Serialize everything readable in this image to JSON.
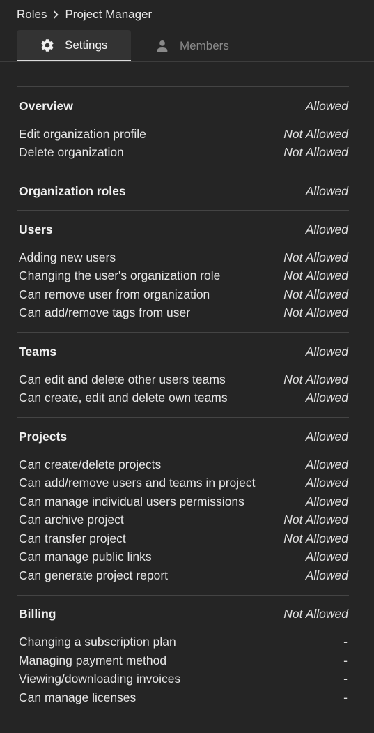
{
  "breadcrumb": {
    "root": "Roles",
    "current": "Project Manager"
  },
  "tabs": [
    {
      "label": "Settings",
      "icon": "gear-icon",
      "active": true
    },
    {
      "label": "Members",
      "icon": "person-icon",
      "active": false
    }
  ],
  "sections": {
    "overview": {
      "title": "Overview",
      "value": "Allowed",
      "items": [
        {
          "label": "Edit organization profile",
          "value": "Not Allowed"
        },
        {
          "label": "Delete organization",
          "value": "Not Allowed"
        }
      ]
    },
    "organization_roles": {
      "title": "Organization roles",
      "value": "Allowed"
    },
    "users": {
      "title": "Users",
      "value": "Allowed",
      "items": [
        {
          "label": "Adding new users",
          "value": "Not Allowed"
        },
        {
          "label": "Changing the user's organization role",
          "value": "Not Allowed"
        },
        {
          "label": "Can remove user from organization",
          "value": "Not Allowed"
        },
        {
          "label": "Can add/remove tags from user",
          "value": "Not Allowed"
        }
      ]
    },
    "teams": {
      "title": "Teams",
      "value": "Allowed",
      "items": [
        {
          "label": "Can edit and delete other users teams",
          "value": "Not Allowed"
        },
        {
          "label": "Can create, edit and delete own teams",
          "value": "Allowed"
        }
      ]
    },
    "projects": {
      "title": "Projects",
      "value": "Allowed",
      "items": [
        {
          "label": "Can create/delete projects",
          "value": "Allowed"
        },
        {
          "label": "Can add/remove users and teams in project",
          "value": "Allowed"
        },
        {
          "label": "Can manage individual users permissions",
          "value": "Allowed"
        },
        {
          "label": "Can archive project",
          "value": "Not Allowed"
        },
        {
          "label": "Can transfer project",
          "value": "Not Allowed"
        },
        {
          "label": "Can manage public links",
          "value": "Allowed"
        },
        {
          "label": "Can generate project report",
          "value": "Allowed"
        }
      ]
    },
    "billing": {
      "title": "Billing",
      "value": "Not Allowed",
      "items": [
        {
          "label": "Changing a subscription plan",
          "value": "-"
        },
        {
          "label": "Managing payment method",
          "value": "-"
        },
        {
          "label": "Viewing/downloading invoices",
          "value": "-"
        },
        {
          "label": "Can manage licenses",
          "value": "-"
        }
      ]
    }
  }
}
